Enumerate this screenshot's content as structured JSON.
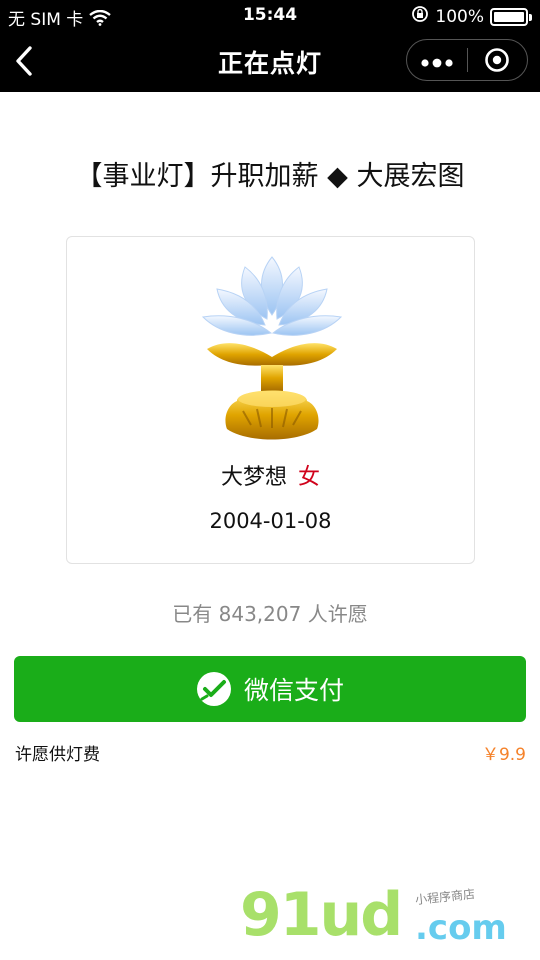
{
  "status_bar": {
    "carrier": "无 SIM 卡",
    "time": "15:44",
    "battery": "100%"
  },
  "nav": {
    "title": "正在点灯",
    "more_icon": "more-dots-icon",
    "close_icon": "target-circle-icon"
  },
  "lamp": {
    "category_title": "【事业灯】升职加薪 ◆ 大展宏图",
    "name": "大梦想",
    "gender": "女",
    "date": "2004-01-08",
    "image_icon": "lotus-lamp-icon"
  },
  "wishers_text": "已有 843,207 人许愿",
  "pay": {
    "button_label": "微信支付",
    "icon": "wechat-pay-icon",
    "fee_label": "许愿供灯费",
    "fee_price": "￥9.9"
  },
  "watermark": {
    "main": "91ud",
    "suffix": ".com",
    "sub": "小程序商店"
  },
  "colors": {
    "nav_bg": "#000000",
    "pay_green": "#1aad19",
    "price_orange": "#f5822a",
    "gender_red": "#d0021b"
  }
}
